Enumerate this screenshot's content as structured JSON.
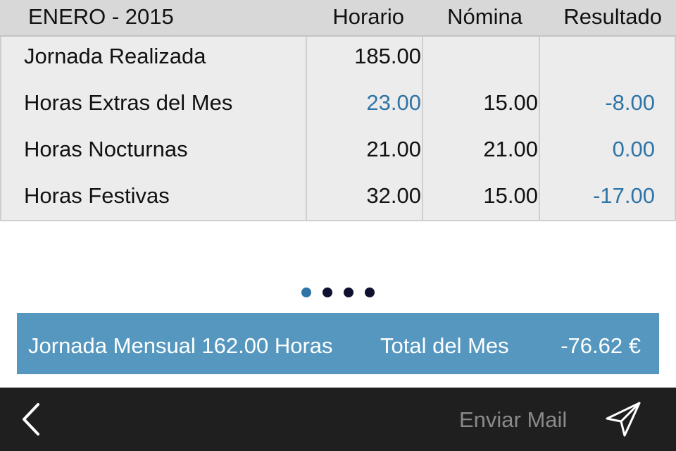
{
  "header": {
    "title": "ENERO - 2015",
    "col_horario": "Horario",
    "col_nomina": "Nómina",
    "col_resultado": "Resultado"
  },
  "rows": [
    {
      "label": "Jornada Realizada",
      "horario": "185.00",
      "nomina": "",
      "resultado": ""
    },
    {
      "label": "Horas Extras del Mes",
      "horario": "23.00",
      "nomina": "15.00",
      "resultado": "-8.00"
    },
    {
      "label": "Horas Nocturnas",
      "horario": "21.00",
      "nomina": "21.00",
      "resultado": "0.00"
    },
    {
      "label": "Horas Festivas",
      "horario": "32.00",
      "nomina": "15.00",
      "resultado": "-17.00"
    }
  ],
  "pager": {
    "count": 4,
    "active_index": 0
  },
  "summary": {
    "jornada": "Jornada Mensual 162.00 Horas",
    "total_label": "Total del Mes",
    "total_value": "-76.62 €"
  },
  "bottom_bar": {
    "back_icon": "chevron-left-icon",
    "mail_label": "Enviar Mail",
    "send_icon": "paper-plane-icon"
  },
  "colors": {
    "accent_blue": "#2f74a6",
    "summary_bg": "#5597bf",
    "bar_bg": "#1f1f1f"
  }
}
